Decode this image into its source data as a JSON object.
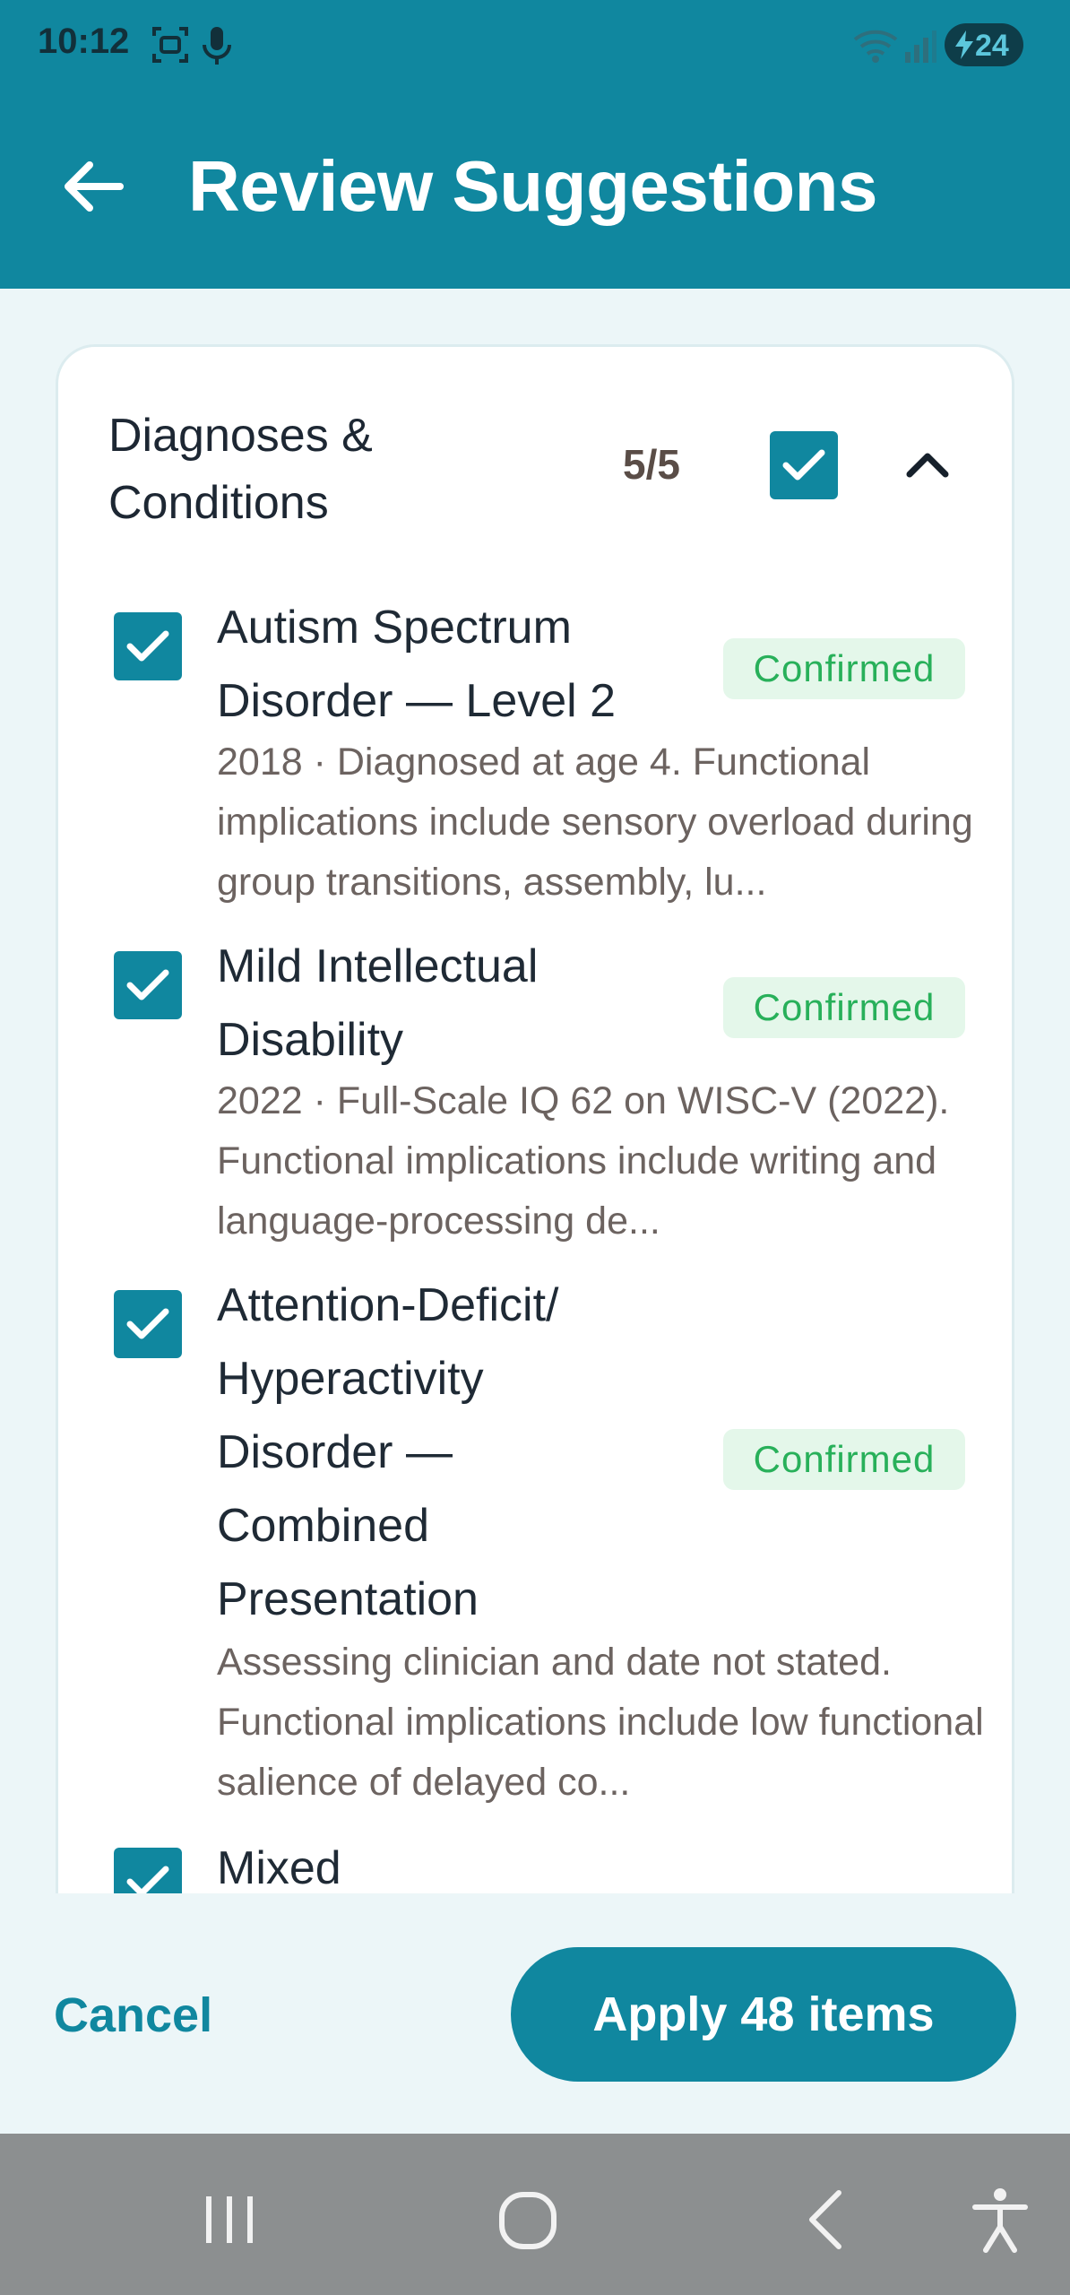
{
  "status_bar": {
    "time": "10:12",
    "battery": "24",
    "battery_level": 24
  },
  "app_bar": {
    "title": "Review Suggestions"
  },
  "section": {
    "title": "Diagnoses & Conditions",
    "count": "5/5",
    "all_selected": true,
    "expanded": true
  },
  "items": [
    {
      "title": "Autism Spectrum Disorder — Level 2",
      "badge": "Confirmed",
      "checked": true,
      "desc": "2018 · Diagnosed at age 4. Functional implications include sensory overload during group transitions, assembly, lu..."
    },
    {
      "title": "Mild Intellectual Disability",
      "badge": "Confirmed",
      "checked": true,
      "desc": "2022 · Full-Scale IQ 62 on WISC-V (2022). Functional implications include writing and language-processing de..."
    },
    {
      "title": "Attention-Deficit/ Hyperactivity Disorder — Combined Presentation",
      "badge": "Confirmed",
      "checked": true,
      "desc": "Assessing clinician and date not stated. Functional implications include low functional salience of delayed co..."
    },
    {
      "title": "Mixed",
      "checked": true
    }
  ],
  "footer": {
    "cancel_label": "Cancel",
    "apply_label": "Apply 48 items"
  },
  "colors": {
    "primary": "#10879f",
    "background": "#ecf6f8",
    "badge_bg": "#e4f7ea",
    "badge_text": "#28b05a"
  },
  "icons": {
    "status": [
      "screenshot-icon",
      "mic-icon",
      "wifi-icon",
      "signal-icon",
      "battery-icon"
    ],
    "nav": [
      "recent-apps-icon",
      "home-icon",
      "back-icon",
      "accessibility-icon"
    ]
  }
}
